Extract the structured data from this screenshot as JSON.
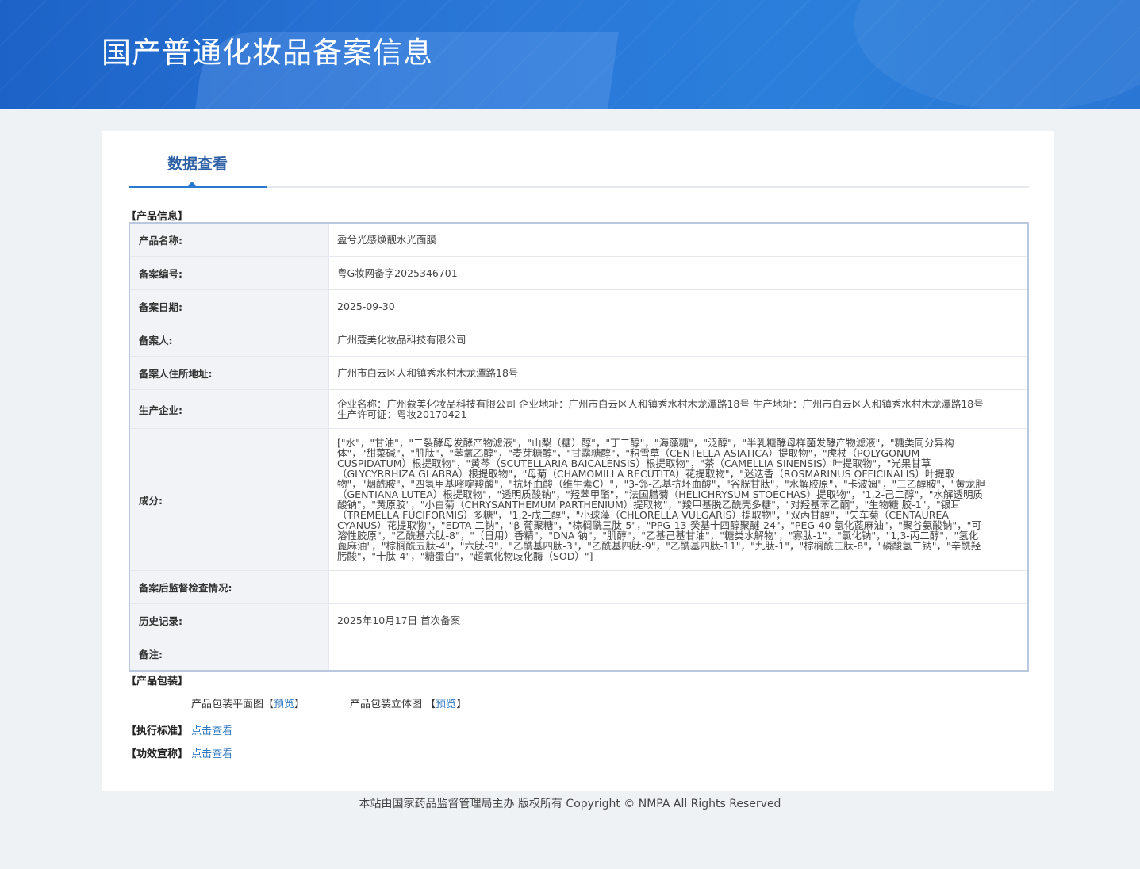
{
  "header": {
    "title": "国产普通化妆品备案信息"
  },
  "tab": {
    "label": "数据查看"
  },
  "product_section": {
    "title": "【产品信息】"
  },
  "product_info": [
    {
      "label": "产品名称:",
      "value": "盈兮光感焕靓水光面膜"
    },
    {
      "label": "备案编号:",
      "value": "粤G妆网备字2025346701"
    },
    {
      "label": "备案日期:",
      "value": "2025-09-30"
    },
    {
      "label": "备案人:",
      "value": "广州蔻美化妆品科技有限公司"
    },
    {
      "label": "备案人住所地址:",
      "value": "广州市白云区人和镇秀水村木龙潭路18号"
    },
    {
      "label": "生产企业:",
      "value": "企业名称：广州蔻美化妆品科技有限公司 企业地址：广州市白云区人和镇秀水村木龙潭路18号 生产地址：广州市白云区人和镇秀水村木龙潭路18号 生产许可证：粤妆20170421"
    },
    {
      "label": "成分:",
      "value": "[\"水\"，\"甘油\"，\"二裂酵母发酵产物滤液\"，\"山梨（糖）醇\"，\"丁二醇\"，\"海藻糖\"，\"泛醇\"，\"半乳糖酵母样菌发酵产物滤液\"，\"糖类同分异构体\"，\"甜菜碱\"，\"肌肽\"，\"苯氧乙醇\"，\"麦芽糖醇\"，\"甘露糖醇\"，\"积雪草（CENTELLA ASIATICA）提取物\"，\"虎杖（POLYGONUM CUSPIDATUM）根提取物\"，\"黄芩（SCUTELLARIA BAICALENSIS）根提取物\"，\"茶（CAMELLIA SINENSIS）叶提取物\"，\"光果甘草（GLYCYRRHIZA GLABRA）根提取物\"，\"母菊（CHAMOMILLA RECUTITA）花提取物\"，\"迷迭香（ROSMARINUS OFFICINALIS）叶提取物\"，\"烟酰胺\"，\"四氢甲基嘧啶羧酸\"，\"抗坏血酸（维生素C）\"，\"3-邻-乙基抗坏血酸\"，\"谷胱甘肽\"，\"水解胶原\"，\"卡波姆\"，\"三乙醇胺\"，\"黄龙胆（GENTIANA LUTEA）根提取物\"，\"透明质酸钠\"，\"羟苯甲酯\"，\"法国腊菊（HELICHRYSUM STOECHAS）提取物\"，\"1,2-己二醇\"，\"水解透明质酸钠\"，\"黄原胶\"，\"小白菊（CHRYSANTHEMUM PARTHENIUM）提取物\"，\"羧甲基脱乙酰壳多糖\"，\"对羟基苯乙酮\"，\"生物糖 胶-1\"，\"银耳（TREMELLA FUCIFORMIS）多糖\"，\"1,2-戊二醇\"，\"小球藻（CHLORELLA VULGARIS）提取物\"，\"双丙甘醇\"，\"矢车菊（CENTAUREA CYANUS）花提取物\"，\"EDTA 二钠\"，\"β-葡聚糖\"，\"棕榈酰三肽-5\"，\"PPG-13-癸基十四醇聚醚-24\"，\"PEG-40 氢化蓖麻油\"，\"聚谷氨酸钠\"，\"可溶性胶原\"，\"乙酰基六肽-8\"，\"（日用）香精\"，\"DNA 钠\"，\"肌醇\"，\"乙基己基甘油\"，\"糖类水解物\"，\"寡肽-1\"，\"氯化钠\"，\"1,3-丙二醇\"，\"氢化蓖麻油\"，\"棕榈酰五肽-4\"，\"六肽-9\"，\"乙酰基四肽-3\"，\"乙酰基四肽-9\"，\"乙酰基四肽-11\"，\"九肽-1\"，\"棕榈酰三肽-8\"，\"磷酸氢二钠\"，\"辛酰羟肟酸\"，\"十肽-4\"，\"糖蛋白\"，\"超氧化物歧化酶（SOD）\"]"
    },
    {
      "label": "备案后监督检查情况:",
      "value": ""
    },
    {
      "label": "历史记录:",
      "value": "2025年10月17日 首次备案"
    },
    {
      "label": "备注:",
      "value": ""
    }
  ],
  "packaging": {
    "title": "【产品包装】",
    "flat_label": "产品包装平面图",
    "flat_bracket_open": "【",
    "flat_link": "预览",
    "flat_bracket_close": "】",
    "stereo_label": "产品包装立体图",
    "stereo_bracket_open": "【",
    "stereo_link": "预览",
    "stereo_bracket_close": "】"
  },
  "standard": {
    "title": "【执行标准】",
    "link": "点击查看"
  },
  "efficacy": {
    "title": "【功效宣称】",
    "link": "点击查看"
  },
  "footer": {
    "text": "本站由国家药品监督管理局主办 版权所有 Copyright © NMPA All Rights Reserved"
  }
}
